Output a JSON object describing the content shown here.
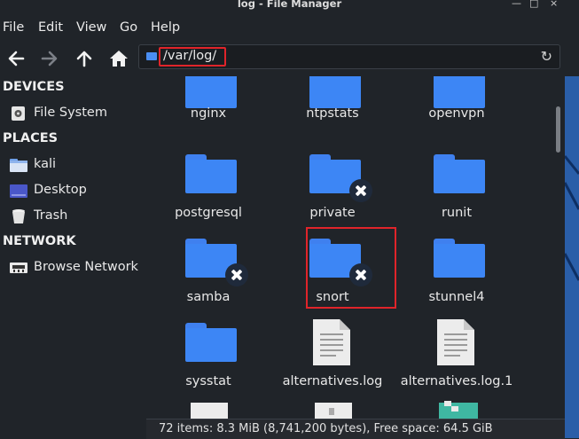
{
  "window": {
    "title": "log - File Manager",
    "minimize": "—",
    "maximize": "□",
    "close": "×"
  },
  "menu": [
    "File",
    "Edit",
    "View",
    "Go",
    "Help"
  ],
  "toolbar": {
    "back_icon": "back-arrow-icon",
    "forward_icon": "forward-arrow-icon",
    "up_icon": "up-arrow-icon",
    "home_icon": "home-icon",
    "path": "/var/log/"
  },
  "sidebar": {
    "devices_heading": "DEVICES",
    "devices": [
      {
        "label": "File System",
        "icon": "drive-icon"
      }
    ],
    "places_heading": "PLACES",
    "places": [
      {
        "label": "kali",
        "icon": "home-folder-icon"
      },
      {
        "label": "Desktop",
        "icon": "desktop-icon"
      },
      {
        "label": "Trash",
        "icon": "trash-icon"
      }
    ],
    "network_heading": "NETWORK",
    "network": [
      {
        "label": "Browse Network",
        "icon": "network-icon"
      }
    ]
  },
  "files": [
    {
      "name": "nginx",
      "type": "folder",
      "locked": false
    },
    {
      "name": "ntpstats",
      "type": "folder",
      "locked": false
    },
    {
      "name": "openvpn",
      "type": "folder",
      "locked": false
    },
    {
      "name": "postgresql",
      "type": "folder",
      "locked": false
    },
    {
      "name": "private",
      "type": "folder",
      "locked": true
    },
    {
      "name": "runit",
      "type": "folder",
      "locked": false
    },
    {
      "name": "samba",
      "type": "folder",
      "locked": true
    },
    {
      "name": "snort",
      "type": "folder",
      "locked": true
    },
    {
      "name": "stunnel4",
      "type": "folder",
      "locked": false
    },
    {
      "name": "sysstat",
      "type": "folder",
      "locked": false
    },
    {
      "name": "alternatives.log",
      "type": "text-file",
      "locked": false
    },
    {
      "name": "alternatives.log.1",
      "type": "text-file",
      "locked": false
    }
  ],
  "status": "72 items: 8.3 MiB (8,741,200 bytes), Free space: 64.5 GiB",
  "colors": {
    "folder": "#3d86f5",
    "highlight": "#e0242a",
    "background": "#202429"
  }
}
